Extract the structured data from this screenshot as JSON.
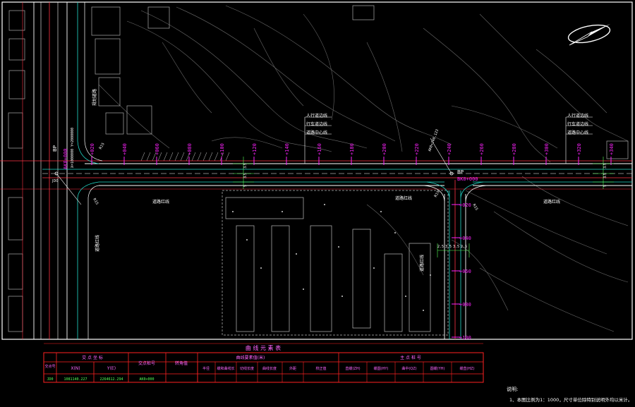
{
  "colors": {
    "background": "#000000",
    "frame": "#ffffff",
    "road_edge": "#ffffff",
    "centerline": "#ff3344",
    "curb": "#22ddcc",
    "station": "#ff22ff",
    "label": "#ffffff",
    "table_border": "#ff2222",
    "table_title": "#ff66ff",
    "table_value": "#55ff55",
    "building": "#bbbbbb",
    "contour": "#777777"
  },
  "compass": {
    "icon": "north-arrow-icon"
  },
  "main_road": {
    "stations": [
      "+020",
      "+040",
      "+060",
      "+080",
      "+100",
      "+120",
      "+140",
      "+160",
      "+180",
      "+200",
      "+220",
      "+240",
      "+260",
      "+280",
      "+300",
      "+320",
      "+340"
    ],
    "start": {
      "bp": "BP",
      "chainage": "AK0+000",
      "coord": "X=1000000 Y=2000000"
    },
    "node_label": "JD0",
    "radius_labels": [
      "R15",
      "R15"
    ],
    "width_dims": [
      "3.5",
      "3.5",
      "5"
    ],
    "width_dims_right": [
      "3.5",
      "3.5",
      "5"
    ],
    "cross_labels_1": [
      "人行道边线",
      "行车道边线",
      "道路中心线"
    ],
    "cross_labels_2": [
      "人行道边线",
      "行车道边线",
      "道路中心线"
    ]
  },
  "branch_road": {
    "stations": [
      "+020",
      "+040",
      "+060",
      "+080",
      "+100"
    ],
    "start": {
      "bp": "BP",
      "chainage": "BK0+000",
      "ref": "AK0+240.123"
    },
    "radius_labels": [
      "R15",
      "R15"
    ],
    "width_dims": [
      "2.5",
      "3.5",
      "3.5",
      "2.5"
    ]
  },
  "area_labels": [
    "道路红线",
    "道路红线",
    "道路红线",
    "道路红线",
    "道路红线",
    "规划道路"
  ],
  "table": {
    "title": "曲 线 元 素 表",
    "col_jd": "交点号",
    "col_coord": "交 点 坐 标",
    "col_x": "X(N)",
    "col_y": "Y(E)",
    "col_station": "交点桩号",
    "col_angle": "转角值",
    "col_elements": "曲线要素值(米)",
    "elem_headers": [
      "半径",
      "缓和曲线长",
      "切线长度",
      "曲线长度",
      "外距",
      "校正值"
    ],
    "col_main_points": "主 点 桩 号",
    "main_point_headers": [
      "直缓(ZH)",
      "缓圆(HY)",
      "曲中(QZ)",
      "圆缓(YH)",
      "缓直(HZ)"
    ],
    "row": {
      "jd": "JD0",
      "x": "1081140.227",
      "y": "2264612.294",
      "station": "AK0+000"
    }
  },
  "notes": {
    "title": "说明:",
    "line1": "1、本图比例为1：1000，尺寸单位除特别说明外均以米计。"
  }
}
